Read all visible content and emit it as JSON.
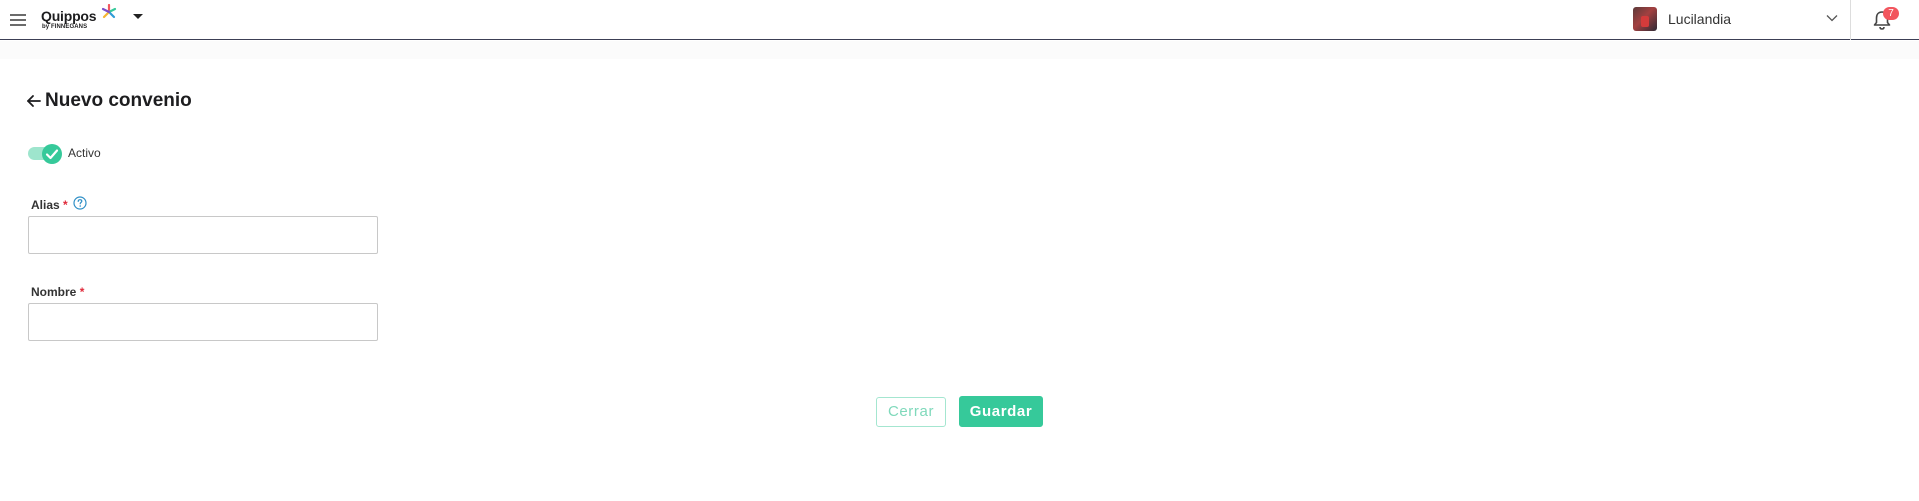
{
  "header": {
    "menu_icon": "hamburger-menu-icon",
    "logo": {
      "name": "Quippos",
      "sub": "by FINNEGANS"
    },
    "user": {
      "name": "Lucilandia",
      "avatar_icon": "user-avatar"
    },
    "notifications": {
      "icon": "bell-icon",
      "count": "7"
    }
  },
  "page": {
    "back_icon": "arrow-left-icon",
    "title": "Nuevo convenio"
  },
  "form": {
    "active_toggle": {
      "label": "Activo",
      "checked": true
    },
    "alias": {
      "label": "Alias",
      "required_mark": "*",
      "help_icon": "question-circle-icon",
      "value": "",
      "placeholder": ""
    },
    "nombre": {
      "label": "Nombre",
      "required_mark": "*",
      "value": "",
      "placeholder": ""
    }
  },
  "actions": {
    "close_label": "Cerrar",
    "save_label": "Guardar"
  },
  "colors": {
    "accent": "#36c99a",
    "accent_light": "#9ee5cd",
    "badge": "#f2565e",
    "required": "#e02a3b"
  }
}
